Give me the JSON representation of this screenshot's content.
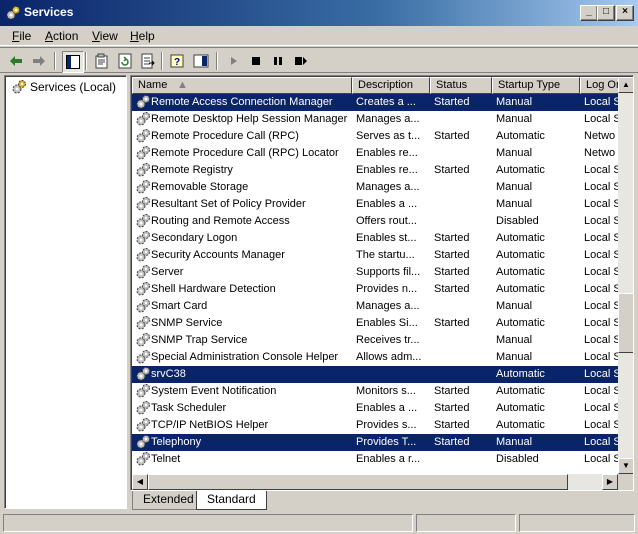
{
  "window": {
    "title": "Services",
    "min": "0",
    "max": "1",
    "close": "r"
  },
  "menu": [
    {
      "pre": "",
      "ul": "F",
      "post": "ile"
    },
    {
      "pre": "",
      "ul": "A",
      "post": "ction"
    },
    {
      "pre": "",
      "ul": "V",
      "post": "iew"
    },
    {
      "pre": "",
      "ul": "H",
      "post": "elp"
    }
  ],
  "tree": {
    "root": "Services (Local)"
  },
  "columns": [
    "Name",
    "Description",
    "Status",
    "Startup Type",
    "Log On As"
  ],
  "rows": [
    {
      "name": "Remote Access Connection Manager",
      "description": "Creates a ...",
      "status": "Started",
      "startup": "Manual",
      "logon": "Local S",
      "selected": true
    },
    {
      "name": "Remote Desktop Help Session Manager",
      "description": "Manages a...",
      "status": "",
      "startup": "Manual",
      "logon": "Local S",
      "selected": false
    },
    {
      "name": "Remote Procedure Call (RPC)",
      "description": "Serves as t...",
      "status": "Started",
      "startup": "Automatic",
      "logon": "Netwo",
      "selected": false
    },
    {
      "name": "Remote Procedure Call (RPC) Locator",
      "description": "Enables re...",
      "status": "",
      "startup": "Manual",
      "logon": "Netwo",
      "selected": false
    },
    {
      "name": "Remote Registry",
      "description": "Enables re...",
      "status": "Started",
      "startup": "Automatic",
      "logon": "Local S",
      "selected": false
    },
    {
      "name": "Removable Storage",
      "description": "Manages a...",
      "status": "",
      "startup": "Manual",
      "logon": "Local S",
      "selected": false
    },
    {
      "name": "Resultant Set of Policy Provider",
      "description": "Enables a ...",
      "status": "",
      "startup": "Manual",
      "logon": "Local S",
      "selected": false
    },
    {
      "name": "Routing and Remote Access",
      "description": "Offers rout...",
      "status": "",
      "startup": "Disabled",
      "logon": "Local S",
      "selected": false
    },
    {
      "name": "Secondary Logon",
      "description": "Enables st...",
      "status": "Started",
      "startup": "Automatic",
      "logon": "Local S",
      "selected": false
    },
    {
      "name": "Security Accounts Manager",
      "description": "The startu...",
      "status": "Started",
      "startup": "Automatic",
      "logon": "Local S",
      "selected": false
    },
    {
      "name": "Server",
      "description": "Supports fil...",
      "status": "Started",
      "startup": "Automatic",
      "logon": "Local S",
      "selected": false
    },
    {
      "name": "Shell Hardware Detection",
      "description": "Provides n...",
      "status": "Started",
      "startup": "Automatic",
      "logon": "Local S",
      "selected": false
    },
    {
      "name": "Smart Card",
      "description": "Manages a...",
      "status": "",
      "startup": "Manual",
      "logon": "Local S",
      "selected": false
    },
    {
      "name": "SNMP Service",
      "description": "Enables Si...",
      "status": "Started",
      "startup": "Automatic",
      "logon": "Local S",
      "selected": false
    },
    {
      "name": "SNMP Trap Service",
      "description": "Receives tr...",
      "status": "",
      "startup": "Manual",
      "logon": "Local S",
      "selected": false
    },
    {
      "name": "Special Administration Console Helper",
      "description": "Allows adm...",
      "status": "",
      "startup": "Manual",
      "logon": "Local S",
      "selected": false
    },
    {
      "name": "srvC38",
      "description": "",
      "status": "",
      "startup": "Automatic",
      "logon": "Local S",
      "selected": true
    },
    {
      "name": "System Event Notification",
      "description": "Monitors s...",
      "status": "Started",
      "startup": "Automatic",
      "logon": "Local S",
      "selected": false
    },
    {
      "name": "Task Scheduler",
      "description": "Enables a ...",
      "status": "Started",
      "startup": "Automatic",
      "logon": "Local S",
      "selected": false
    },
    {
      "name": "TCP/IP NetBIOS Helper",
      "description": "Provides s...",
      "status": "Started",
      "startup": "Automatic",
      "logon": "Local S",
      "selected": false
    },
    {
      "name": "Telephony",
      "description": "Provides T...",
      "status": "Started",
      "startup": "Manual",
      "logon": "Local S",
      "selected": true
    },
    {
      "name": "Telnet",
      "description": "Enables a r...",
      "status": "",
      "startup": "Disabled",
      "logon": "Local S",
      "selected": false
    }
  ],
  "tabs": [
    {
      "label": "Extended",
      "active": false
    },
    {
      "label": "Standard",
      "active": true
    }
  ],
  "colors": {
    "selection": "#0a246a",
    "face": "#d4d0c8",
    "titlebar": "#0a246a"
  }
}
